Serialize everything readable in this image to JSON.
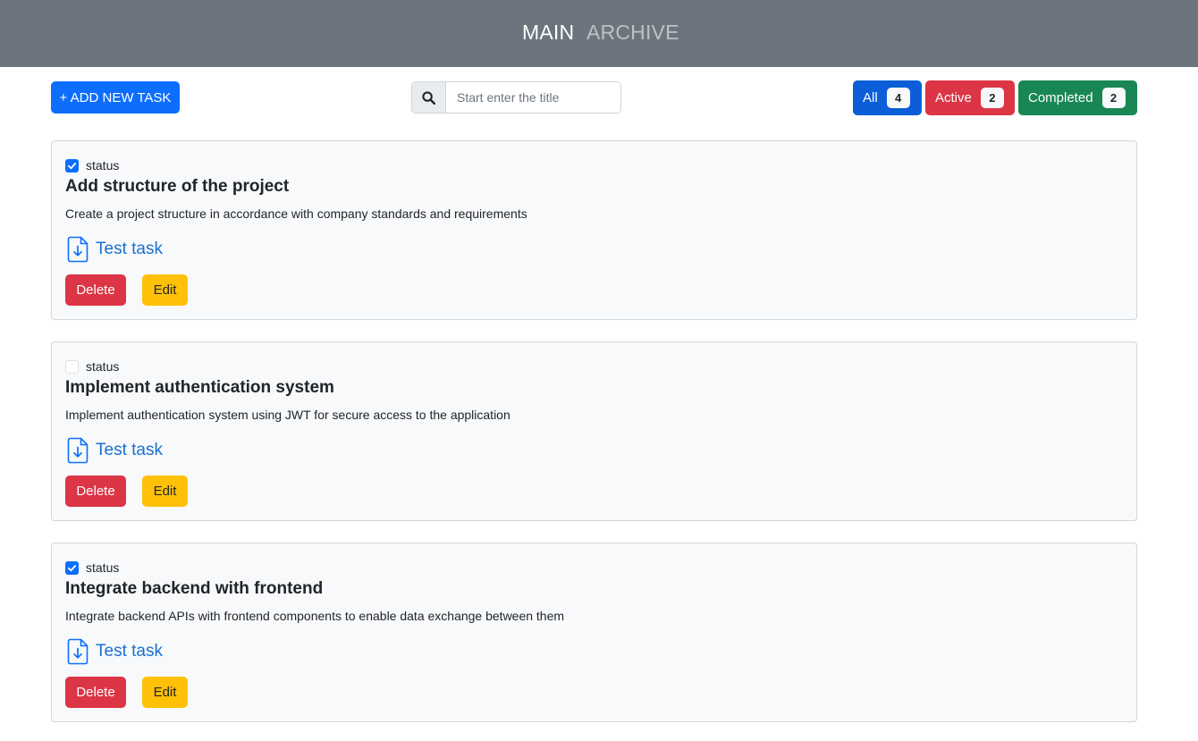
{
  "nav": {
    "main_label": "MAIN",
    "archive_label": "ARCHIVE"
  },
  "toolbar": {
    "add_label": "+ ADD NEW TASK",
    "search_placeholder": "Start enter the title",
    "search_value": "",
    "search_icon": "search-icon"
  },
  "filters": {
    "all": {
      "label": "All",
      "count": "4"
    },
    "active": {
      "label": "Active",
      "count": "2"
    },
    "completed": {
      "label": "Completed",
      "count": "2"
    }
  },
  "tasks": [
    {
      "checked": true,
      "status_label": "status",
      "title": "Add structure of the project",
      "description": "Create a project structure in accordance with company standards and requirements",
      "file_label": "Test task",
      "delete_label": "Delete",
      "edit_label": "Edit"
    },
    {
      "checked": false,
      "status_label": "status",
      "title": "Implement authentication system",
      "description": "Implement authentication system using JWT for secure access to the application",
      "file_label": "Test task",
      "delete_label": "Delete",
      "edit_label": "Edit"
    },
    {
      "checked": true,
      "status_label": "status",
      "title": "Integrate backend with frontend",
      "description": "Integrate backend APIs with frontend components to enable data exchange between them",
      "file_label": "Test task",
      "delete_label": "Delete",
      "edit_label": "Edit"
    }
  ],
  "colors": {
    "navbar": "#6c757d",
    "primary": "#0d6efd",
    "danger": "#dc3545",
    "success": "#198754",
    "warning": "#ffc107"
  }
}
